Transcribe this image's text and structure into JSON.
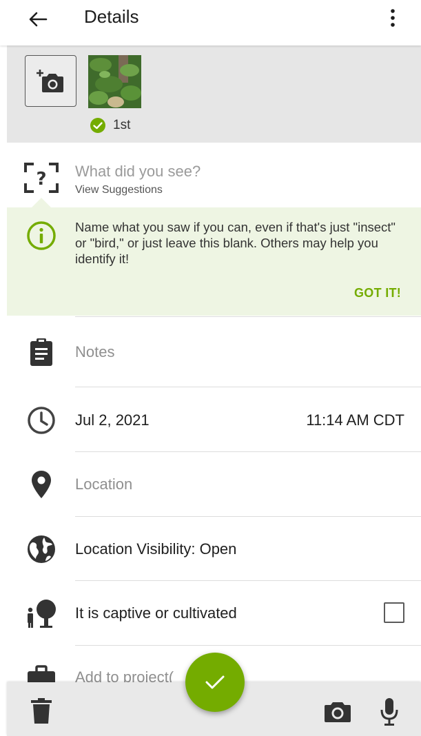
{
  "app_bar": {
    "title": "Details",
    "back_icon": "arrow-left-icon",
    "more_icon": "more-vertical-icon"
  },
  "photos": {
    "add_photo_icon": "add-photo-camera-icon",
    "first_label": "1st"
  },
  "species": {
    "placeholder": "What did you see?",
    "suggestions_link": "View Suggestions"
  },
  "tip": {
    "text": "Name what you saw if you can, even if that's just \"insect\" or \"bird,\" or just leave this blank. Others may help you identify it!",
    "dismiss_label": "GOT IT!"
  },
  "notes": {
    "placeholder": "Notes"
  },
  "datetime": {
    "date": "Jul 2, 2021",
    "time": "11:14 AM CDT"
  },
  "location": {
    "placeholder": "Location"
  },
  "visibility": {
    "label": "Location Visibility: Open"
  },
  "captive": {
    "label": "It is captive or cultivated",
    "checked": false
  },
  "project": {
    "label": "Add to project("
  },
  "colors": {
    "accent": "#74ac00",
    "tip_background": "#eef5e3"
  }
}
